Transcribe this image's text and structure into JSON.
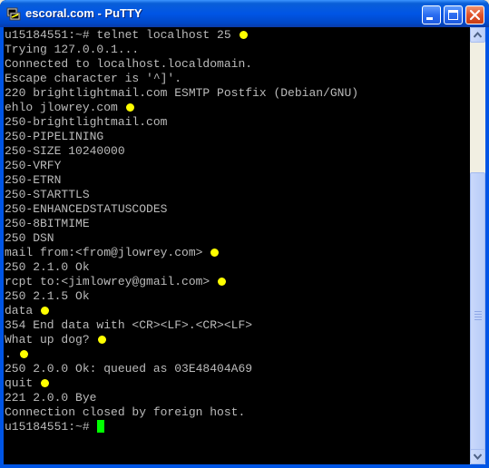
{
  "window": {
    "title": "escoral.com - PuTTY",
    "app_icon": "putty-terminal-icon",
    "controls": [
      "minimize-icon",
      "maximize-icon",
      "close-icon"
    ]
  },
  "colors": {
    "titlebar": "#0055e5",
    "terminal_background": "#000000",
    "terminal_text": "#bbbbbb",
    "annotation_marker": "#ffff00",
    "cursor": "#00ff00"
  },
  "terminal": {
    "lines": [
      {
        "text": "u15184551:~# telnet localhost 25",
        "marked": true
      },
      {
        "text": "Trying 127.0.0.1...",
        "marked": false
      },
      {
        "text": "Connected to localhost.localdomain.",
        "marked": false
      },
      {
        "text": "Escape character is '^]'.",
        "marked": false
      },
      {
        "text": "220 brightlightmail.com ESMTP Postfix (Debian/GNU)",
        "marked": false
      },
      {
        "text": "ehlo jlowrey.com",
        "marked": true
      },
      {
        "text": "250-brightlightmail.com",
        "marked": false
      },
      {
        "text": "250-PIPELINING",
        "marked": false
      },
      {
        "text": "250-SIZE 10240000",
        "marked": false
      },
      {
        "text": "250-VRFY",
        "marked": false
      },
      {
        "text": "250-ETRN",
        "marked": false
      },
      {
        "text": "250-STARTTLS",
        "marked": false
      },
      {
        "text": "250-ENHANCEDSTATUSCODES",
        "marked": false
      },
      {
        "text": "250-8BITMIME",
        "marked": false
      },
      {
        "text": "250 DSN",
        "marked": false
      },
      {
        "text": "mail from:<from@jlowrey.com>",
        "marked": true
      },
      {
        "text": "250 2.1.0 Ok",
        "marked": false
      },
      {
        "text": "rcpt to:<jimlowrey@gmail.com>",
        "marked": true
      },
      {
        "text": "250 2.1.5 Ok",
        "marked": false
      },
      {
        "text": "data",
        "marked": true
      },
      {
        "text": "354 End data with <CR><LF>.<CR><LF>",
        "marked": false
      },
      {
        "text": "What up dog?",
        "marked": true
      },
      {
        "text": ".",
        "marked": true
      },
      {
        "text": "250 2.0.0 Ok: queued as 03E48404A69",
        "marked": false
      },
      {
        "text": "quit",
        "marked": true
      },
      {
        "text": "221 2.0.0 Bye",
        "marked": false
      },
      {
        "text": "Connection closed by foreign host.",
        "marked": false
      },
      {
        "text": "u15184551:~#",
        "marked": false,
        "cursor": true
      }
    ]
  },
  "scrollbar": {
    "position_fraction": 0.32,
    "visible_fraction": 0.7
  }
}
